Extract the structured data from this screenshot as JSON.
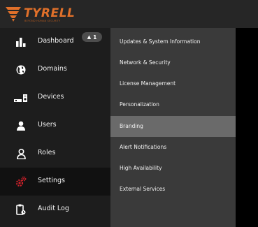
{
  "brand": {
    "name": "TYRELL",
    "tagline": "BEYOND HUMAN SECURITY",
    "color": "#e0702a"
  },
  "sidebar": {
    "items": [
      {
        "label": "Dashboard",
        "icon": "bar-chart-icon",
        "badge": "1",
        "badge_icon": "warning-triangle-icon"
      },
      {
        "label": "Domains",
        "icon": "globe-icon"
      },
      {
        "label": "Devices",
        "icon": "devices-icon"
      },
      {
        "label": "Users",
        "icon": "user-icon"
      },
      {
        "label": "Roles",
        "icon": "person-outline-icon"
      },
      {
        "label": "Settings",
        "icon": "gears-icon",
        "active": true
      },
      {
        "label": "Audit Log",
        "icon": "clipboard-icon"
      }
    ]
  },
  "submenu": {
    "items": [
      {
        "label": "Updates & System Information"
      },
      {
        "label": "Network & Security"
      },
      {
        "label": "License Management"
      },
      {
        "label": "Personalization"
      },
      {
        "label": "Branding",
        "active": true
      },
      {
        "label": "Alert Notifications"
      },
      {
        "label": "High Availability"
      },
      {
        "label": "External Services"
      }
    ]
  },
  "colors": {
    "accent": "#e0702a",
    "settings_icon": "#d0212b"
  }
}
